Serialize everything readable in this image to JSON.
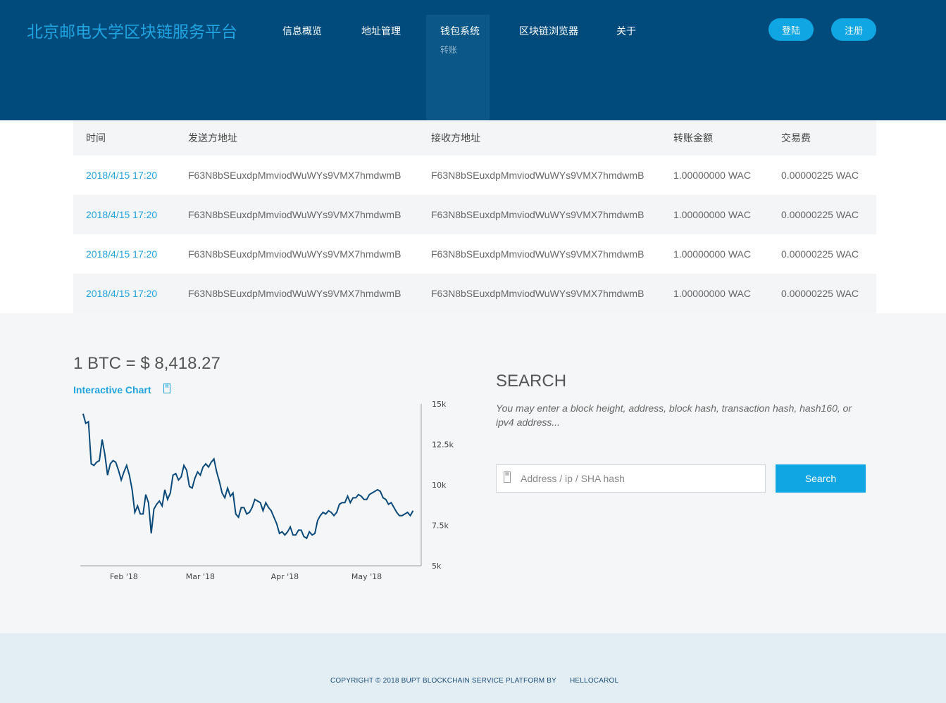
{
  "header": {
    "brand": "北京邮电大学区块链服务平台",
    "nav": [
      {
        "label": "信息概览"
      },
      {
        "label": "地址管理"
      },
      {
        "label": "钱包系统",
        "sub": "转账"
      },
      {
        "label": "区块链浏览器"
      },
      {
        "label": "关于"
      }
    ],
    "login_label": "登陆",
    "register_label": "注册"
  },
  "table": {
    "headers": [
      "时间",
      "发送方地址",
      "接收方地址",
      "转账金额",
      "交易费"
    ],
    "rows": [
      {
        "time": "2018/4/15 17:20",
        "from": "F63N8bSEuxdpMmviodWuWYs9VMX7hmdwmB",
        "to": "F63N8bSEuxdpMmviodWuWYs9VMX7hmdwmB",
        "amount": "1.00000000 WAC",
        "fee": "0.00000225 WAC"
      },
      {
        "time": "2018/4/15 17:20",
        "from": "F63N8bSEuxdpMmviodWuWYs9VMX7hmdwmB",
        "to": "F63N8bSEuxdpMmviodWuWYs9VMX7hmdwmB",
        "amount": "1.00000000 WAC",
        "fee": "0.00000225 WAC"
      },
      {
        "time": "2018/4/15 17:20",
        "from": "F63N8bSEuxdpMmviodWuWYs9VMX7hmdwmB",
        "to": "F63N8bSEuxdpMmviodWuWYs9VMX7hmdwmB",
        "amount": "1.00000000 WAC",
        "fee": "0.00000225 WAC"
      },
      {
        "time": "2018/4/15 17:20",
        "from": "F63N8bSEuxdpMmviodWuWYs9VMX7hmdwmB",
        "to": "F63N8bSEuxdpMmviodWuWYs9VMX7hmdwmB",
        "amount": "1.00000000 WAC",
        "fee": "0.00000225 WAC"
      }
    ]
  },
  "price": {
    "text": "1 BTC = $ 8,418.27",
    "chart_link": "Interactive Chart"
  },
  "chart_data": {
    "type": "line",
    "title": "",
    "xlabel": "",
    "ylabel": "",
    "ylim": [
      5000,
      15000
    ],
    "yticks": [
      "15k",
      "12.5k",
      "10k",
      "7.5k",
      "5k"
    ],
    "xticks": [
      "Feb '18",
      "Mar '18",
      "Apr '18",
      "May '18"
    ],
    "series_color": "#0a4a7a",
    "x": [
      "2018-01-17",
      "2018-01-18",
      "2018-01-19",
      "2018-01-20",
      "2018-01-21",
      "2018-01-22",
      "2018-01-23",
      "2018-01-24",
      "2018-01-25",
      "2018-01-26",
      "2018-01-27",
      "2018-01-28",
      "2018-01-29",
      "2018-01-30",
      "2018-01-31",
      "2018-02-01",
      "2018-02-02",
      "2018-02-03",
      "2018-02-04",
      "2018-02-05",
      "2018-02-06",
      "2018-02-07",
      "2018-02-08",
      "2018-02-09",
      "2018-02-10",
      "2018-02-11",
      "2018-02-12",
      "2018-02-13",
      "2018-02-14",
      "2018-02-15",
      "2018-02-16",
      "2018-02-17",
      "2018-02-18",
      "2018-02-19",
      "2018-02-20",
      "2018-02-21",
      "2018-02-22",
      "2018-02-23",
      "2018-02-24",
      "2018-02-25",
      "2018-02-26",
      "2018-02-27",
      "2018-02-28",
      "2018-03-01",
      "2018-03-02",
      "2018-03-03",
      "2018-03-04",
      "2018-03-05",
      "2018-03-06",
      "2018-03-07",
      "2018-03-08",
      "2018-03-09",
      "2018-03-10",
      "2018-03-11",
      "2018-03-12",
      "2018-03-13",
      "2018-03-14",
      "2018-03-15",
      "2018-03-16",
      "2018-03-17",
      "2018-03-18",
      "2018-03-19",
      "2018-03-20",
      "2018-03-21",
      "2018-03-22",
      "2018-03-23",
      "2018-03-24",
      "2018-03-25",
      "2018-03-26",
      "2018-03-27",
      "2018-03-28",
      "2018-03-29",
      "2018-03-30",
      "2018-03-31",
      "2018-04-01",
      "2018-04-02",
      "2018-04-03",
      "2018-04-04",
      "2018-04-05",
      "2018-04-06",
      "2018-04-07",
      "2018-04-08",
      "2018-04-09",
      "2018-04-10",
      "2018-04-11",
      "2018-04-12",
      "2018-04-13",
      "2018-04-14",
      "2018-04-15",
      "2018-04-16",
      "2018-04-17",
      "2018-04-18",
      "2018-04-19",
      "2018-04-20",
      "2018-04-21",
      "2018-04-22",
      "2018-04-23",
      "2018-04-24",
      "2018-04-25",
      "2018-04-26",
      "2018-04-27",
      "2018-04-28",
      "2018-04-29",
      "2018-04-30",
      "2018-05-01",
      "2018-05-02",
      "2018-05-03",
      "2018-05-04",
      "2018-05-05",
      "2018-05-06",
      "2018-05-07",
      "2018-05-08",
      "2018-05-09",
      "2018-05-10",
      "2018-05-11",
      "2018-05-12",
      "2018-05-13",
      "2018-05-14",
      "2018-05-15",
      "2018-05-16",
      "2018-05-17",
      "2018-05-18"
    ],
    "values": [
      14400,
      13800,
      13900,
      11300,
      11200,
      11400,
      11500,
      12800,
      11900,
      10600,
      11300,
      11500,
      11400,
      10900,
      10300,
      10800,
      11200,
      10600,
      9700,
      8300,
      8700,
      8200,
      8200,
      9400,
      8900,
      7000,
      8500,
      8800,
      9000,
      8700,
      9700,
      9100,
      9500,
      10600,
      10700,
      10300,
      10500,
      11200,
      10900,
      9900,
      9800,
      10400,
      10800,
      10600,
      11100,
      11300,
      11100,
      11400,
      11600,
      10800,
      10200,
      9500,
      9200,
      9800,
      9300,
      9500,
      8200,
      8000,
      8600,
      8600,
      8200,
      8300,
      8600,
      9100,
      9000,
      8900,
      8400,
      8900,
      8600,
      8400,
      8000,
      7600,
      7000,
      7100,
      6900,
      7100,
      7400,
      6900,
      6900,
      7200,
      7200,
      6800,
      6700,
      7100,
      6900,
      7000,
      7800,
      8100,
      8300,
      8200,
      8400,
      8300,
      8100,
      8300,
      8800,
      8900,
      8900,
      9300,
      8900,
      9200,
      9200,
      9400,
      9300,
      9100,
      9100,
      9400,
      9500,
      9600,
      9700,
      9600,
      9200,
      9100,
      8800,
      8900,
      8600,
      8300,
      8100,
      8100,
      8200,
      8300,
      8100,
      8400
    ]
  },
  "search": {
    "title": "SEARCH",
    "description": "You may enter a block height, address, block hash, transaction hash, hash160, or ipv4 address...",
    "placeholder": "Address / ip / SHA hash",
    "button_label": "Search"
  },
  "footer": {
    "copyright": "COPYRIGHT © 2018 BUPT BLOCKCHAIN SERVICE PLATFORM BY",
    "author": "HELLOCAROL"
  }
}
